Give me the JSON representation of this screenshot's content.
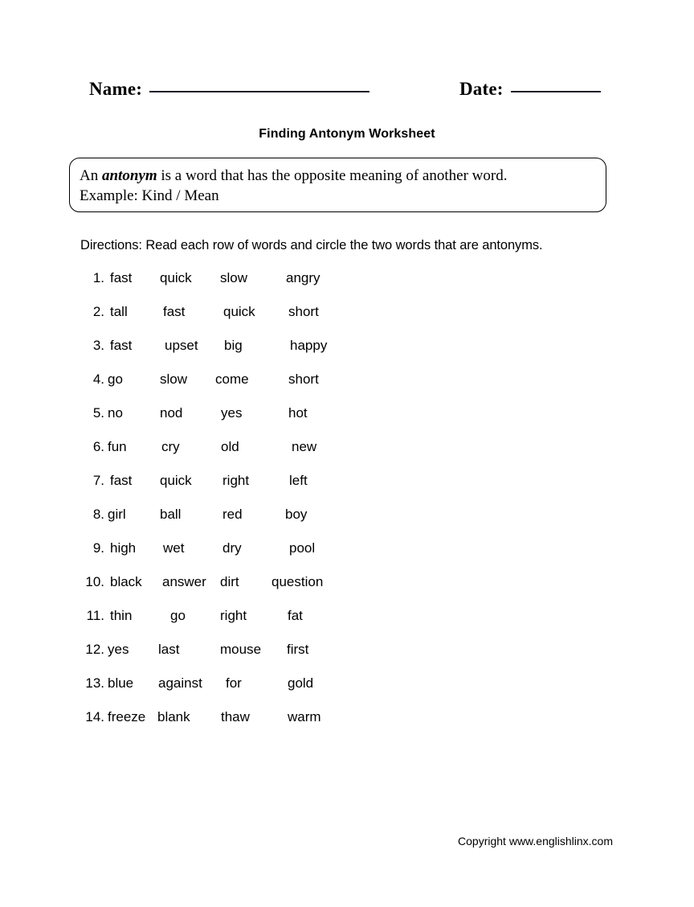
{
  "header": {
    "name_label": "Name:",
    "date_label": "Date:"
  },
  "title": "Finding Antonym Worksheet",
  "definition": {
    "line1_before": "An ",
    "line1_term": "antonym",
    "line1_after": " is a word that has the opposite meaning of another word.",
    "line2": "Example: Kind / Mean"
  },
  "directions": "Directions: Read each row of words and circle the two words that are antonyms.",
  "rows": [
    {
      "number": "1.",
      "words": [
        "fast",
        "quick",
        "slow",
        "angry"
      ]
    },
    {
      "number": "2.",
      "words": [
        "tall",
        "fast",
        "quick",
        "short"
      ]
    },
    {
      "number": "3.",
      "words": [
        "fast",
        "upset",
        "big",
        "happy"
      ]
    },
    {
      "number": "4.",
      "words": [
        "go",
        "slow",
        "come",
        "short"
      ]
    },
    {
      "number": "5.",
      "words": [
        "no",
        "nod",
        "yes",
        "hot"
      ]
    },
    {
      "number": "6.",
      "words": [
        "fun",
        "cry",
        "old",
        "new"
      ]
    },
    {
      "number": "7.",
      "words": [
        "fast",
        "quick",
        "right",
        "left"
      ]
    },
    {
      "number": "8.",
      "words": [
        "girl",
        "ball",
        "red",
        "boy"
      ]
    },
    {
      "number": "9.",
      "words": [
        "high",
        "wet",
        "dry",
        "pool"
      ]
    },
    {
      "number": "10.",
      "words": [
        "black",
        "answer",
        "dirt",
        "question"
      ]
    },
    {
      "number": "11.",
      "words": [
        "thin",
        "go",
        "right",
        "fat"
      ]
    },
    {
      "number": "12.",
      "words": [
        "yes",
        "last",
        "mouse",
        "first"
      ]
    },
    {
      "number": "13.",
      "words": [
        "blue",
        "against",
        "for",
        "gold"
      ]
    },
    {
      "number": "14.",
      "words": [
        "freeze",
        "blank",
        "thaw",
        "warm"
      ]
    }
  ],
  "footer": {
    "copyright": "Copyright www.englishlinx.com"
  }
}
